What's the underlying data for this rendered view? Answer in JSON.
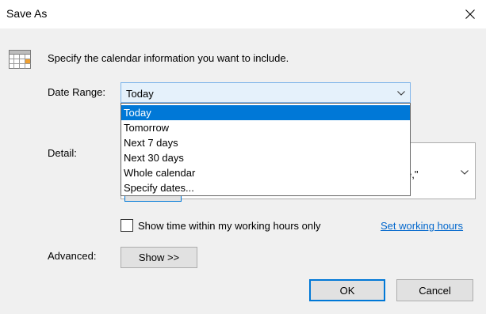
{
  "window": {
    "title": "Save As",
    "close_glyph": "✕"
  },
  "intro": "Specify the calendar information you want to include.",
  "date_range": {
    "label": "Date Range:",
    "selected": "Today",
    "options": [
      "Today",
      "Tomorrow",
      "Next 7 days",
      "Next 30 days",
      "Whole calendar",
      "Specify dates..."
    ]
  },
  "detail": {
    "label": "Detail:",
    "visible_fragment": "tive,\""
  },
  "working_hours": {
    "checkbox_label": "Show time within my working hours only",
    "checked": false,
    "link": "Set working hours"
  },
  "advanced": {
    "label": "Advanced:",
    "show_button": "Show >>"
  },
  "buttons": {
    "ok": "OK",
    "cancel": "Cancel"
  },
  "icons": {
    "calendar": "calendar-icon",
    "dropdown": "chevron-down-icon",
    "close": "close-icon"
  },
  "colors": {
    "selection": "#0078d7",
    "combo_focus_bg": "#e5f1fb",
    "link": "#0066cc"
  }
}
